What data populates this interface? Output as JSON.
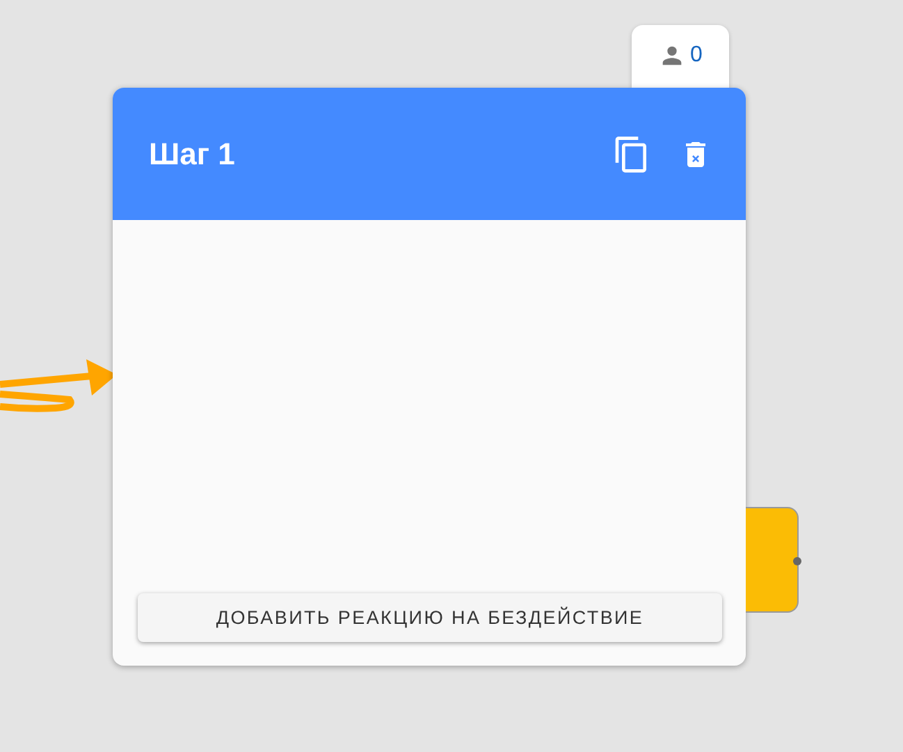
{
  "counter": {
    "value": "0"
  },
  "step": {
    "title": "Шаг 1",
    "button": "ДОБАВИТЬ РЕАКЦИЮ НА БЕЗДЕЙСТВИЕ"
  }
}
